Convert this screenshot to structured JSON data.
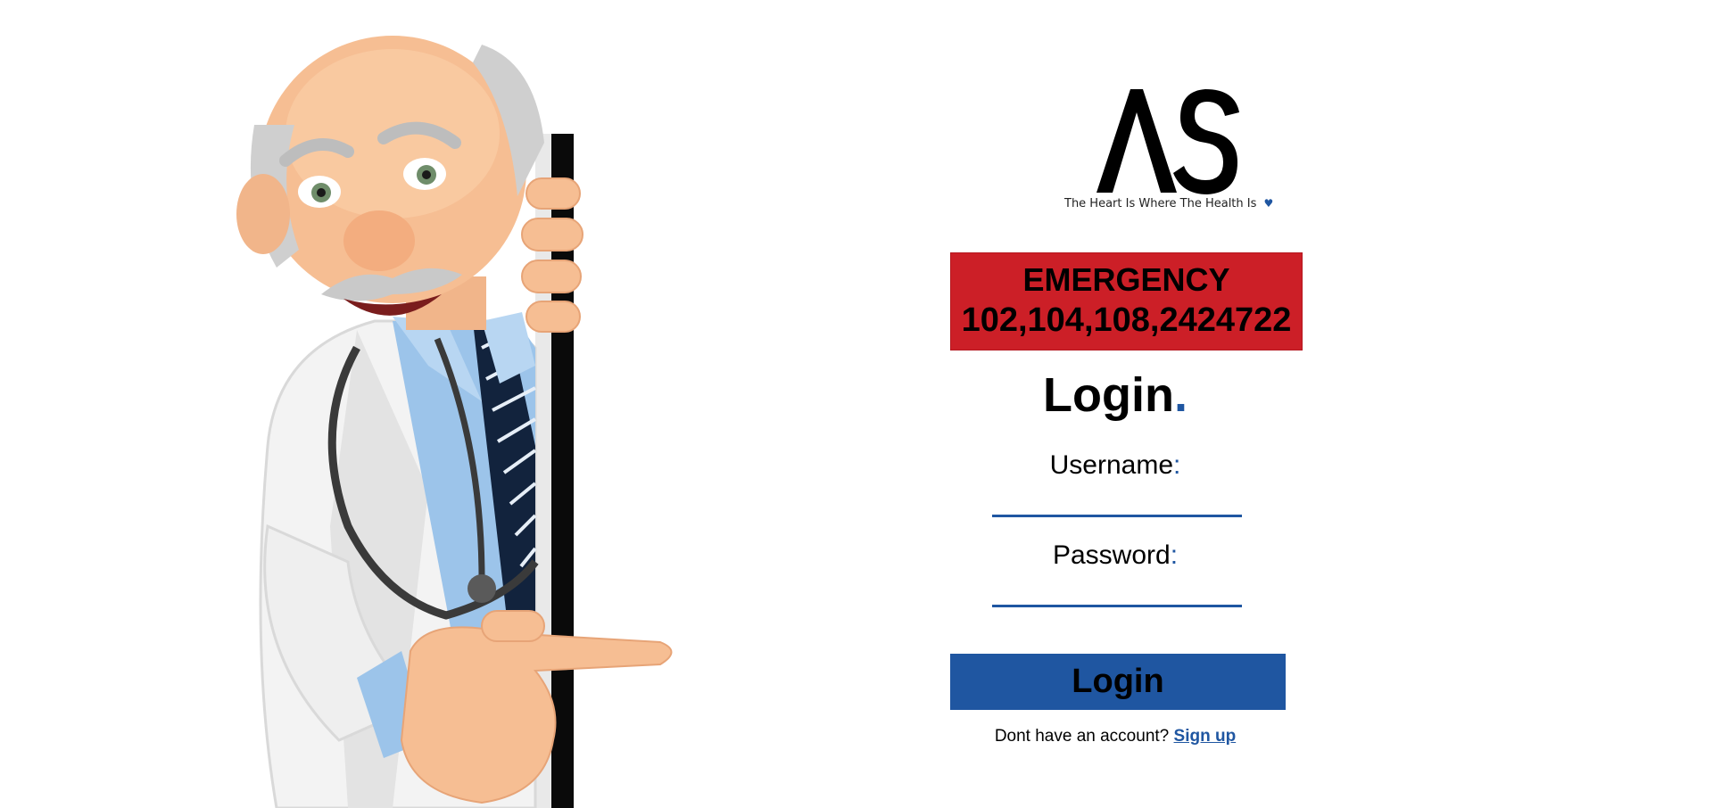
{
  "brand": {
    "logo_text": "AS",
    "tagline": "The Heart Is Where The Health Is",
    "heart_icon": "heart-icon",
    "accent_color": "#1f56a1"
  },
  "emergency": {
    "title": "EMERGENCY",
    "numbers": "102,104,108,2424722",
    "background_color": "#cc1f27"
  },
  "login_form": {
    "heading": "Login",
    "heading_dot": ".",
    "username_label": "Username",
    "password_label": "Password",
    "label_colon": ":",
    "username_value": "",
    "password_value": "",
    "submit_label": "Login"
  },
  "signup": {
    "prompt": "Dont have an account?",
    "link_label": "Sign up"
  },
  "illustration": {
    "icon": "doctor-pointing-illustration"
  }
}
